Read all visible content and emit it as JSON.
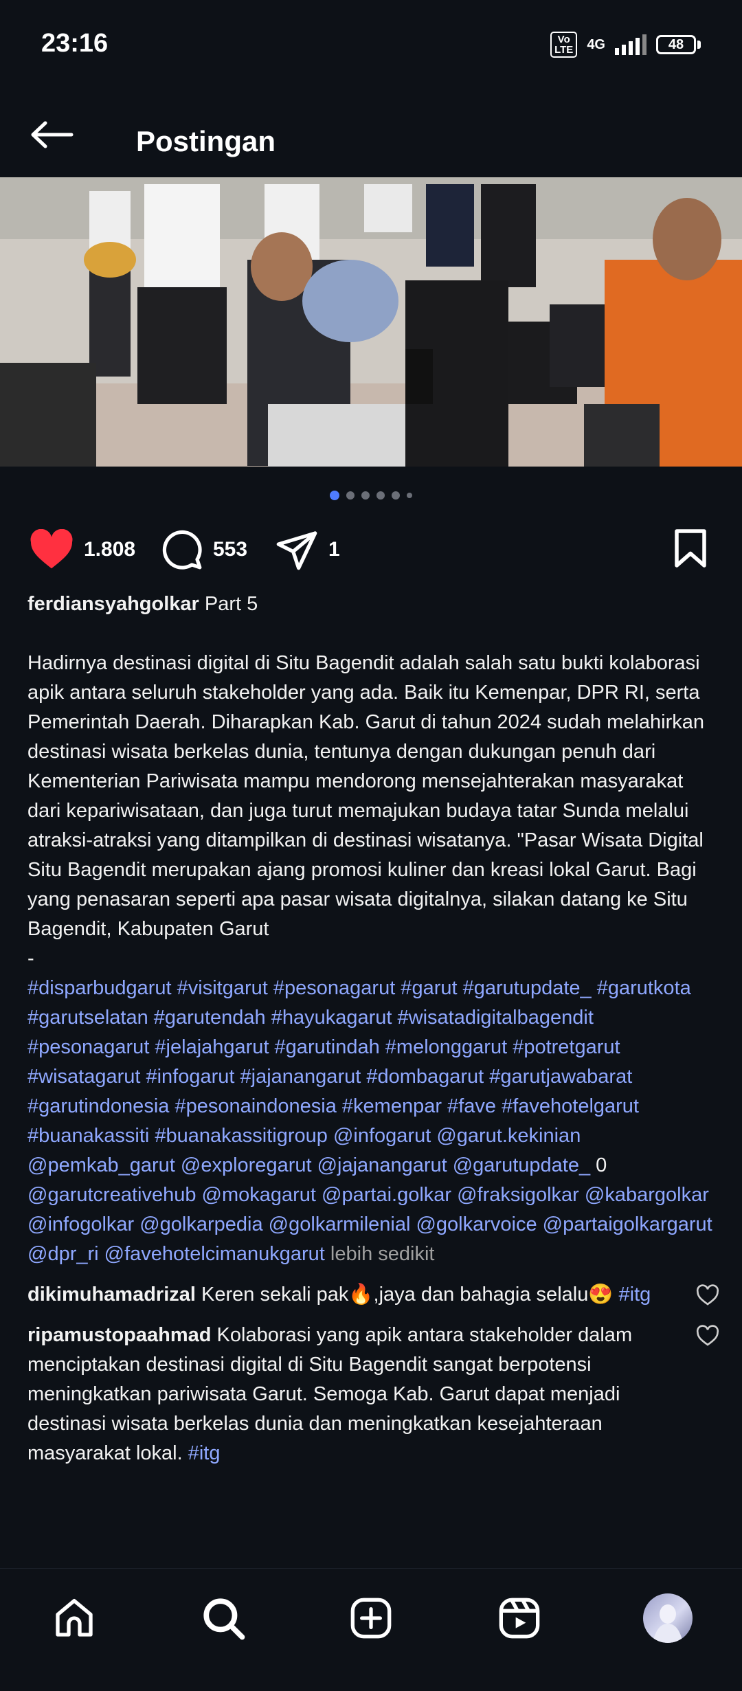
{
  "status_bar": {
    "time": "23:16",
    "volte": "Vo\nLTE",
    "network": "4G",
    "battery": "48"
  },
  "header": {
    "title": "Postingan",
    "back_icon": "arrow-left-icon"
  },
  "post": {
    "image_description": "photo",
    "carousel": {
      "count": 6,
      "active_index": 0
    },
    "likes": "1.808",
    "comments_count": "553",
    "shares": "1",
    "author": "ferdiansyahgolkar",
    "caption_title": "Part 5",
    "caption_body": "Hadirnya destinasi digital di Situ Bagendit adalah salah satu bukti kolaborasi apik antara seluruh stakeholder yang ada. Baik itu Kemenpar, DPR RI, serta Pemerintah Daerah. Diharapkan Kab. Garut di tahun 2024 sudah melahirkan destinasi wisata berkelas dunia, tentunya dengan dukungan penuh dari Kementerian Pariwisata mampu mendorong mensejahterakan masyarakat dari kepariwisataan, dan juga turut memajukan budaya tatar Sunda melalui atraksi-atraksi yang ditampilkan di destinasi wisatanya. \"Pasar Wisata Digital Situ Bagendit merupakan ajang promosi kuliner dan kreasi lokal Garut. Bagi yang penasaran seperti apa pasar wisata digitalnya, silakan datang ke Situ Bagendit, Kabupaten Garut",
    "separator": "-",
    "hashtags_1": "#disparbudgarut #visitgarut #pesonagarut #garut #garutupdate_ #garutkota #garutselatan #garutendah #hayukagarut #wisatadigitalbagendit #pesonagarut #jelajahgarut #garutindah #melonggarut #potretgarut #wisatagarut #infogarut #jajanangarut #dombagarut #garutjawabarat #garutindonesia #pesonaindonesia #kemenpar #fave #favehotelgarut #buanakassiti #buanakassitigroup @infogarut @garut.kekinian @pemkab_garut @exploregarut @jajanangarut @garutupdate_",
    "stray_zero": " 0 ",
    "hashtags_2": "@garutcreativehub @mokagarut @partai.golkar @fraksigolkar @kabargolkar @infogolkar @golkarpedia @golkarmilenial @golkarvoice @partaigolkargarut @dpr_ri @favehotelcimanukgarut",
    "less_label": " lebih sedikit"
  },
  "comments": [
    {
      "user": "dikimuhamadrizal",
      "text": " Keren sekali pak🔥,jaya dan bahagia selalu😍 ",
      "tag": "#itg"
    },
    {
      "user": "ripamustopaahmad",
      "text": " Kolaborasi yang apik antara stakeholder dalam menciptakan destinasi digital di Situ Bagendit sangat berpotensi meningkatkan pariwisata Garut. Semoga Kab. Garut dapat menjadi destinasi wisata berkelas dunia dan meningkatkan kesejahteraan masyarakat lokal. ",
      "tag": "#itg"
    }
  ],
  "bottom_nav": [
    {
      "name": "home-icon"
    },
    {
      "name": "search-icon"
    },
    {
      "name": "add-post-icon"
    },
    {
      "name": "reels-icon"
    },
    {
      "name": "profile-avatar"
    }
  ],
  "colors": {
    "background": "#0d1117",
    "like_red": "#ff3040",
    "link_blue": "#8fa8ff",
    "active_dot": "#4f7cff"
  }
}
